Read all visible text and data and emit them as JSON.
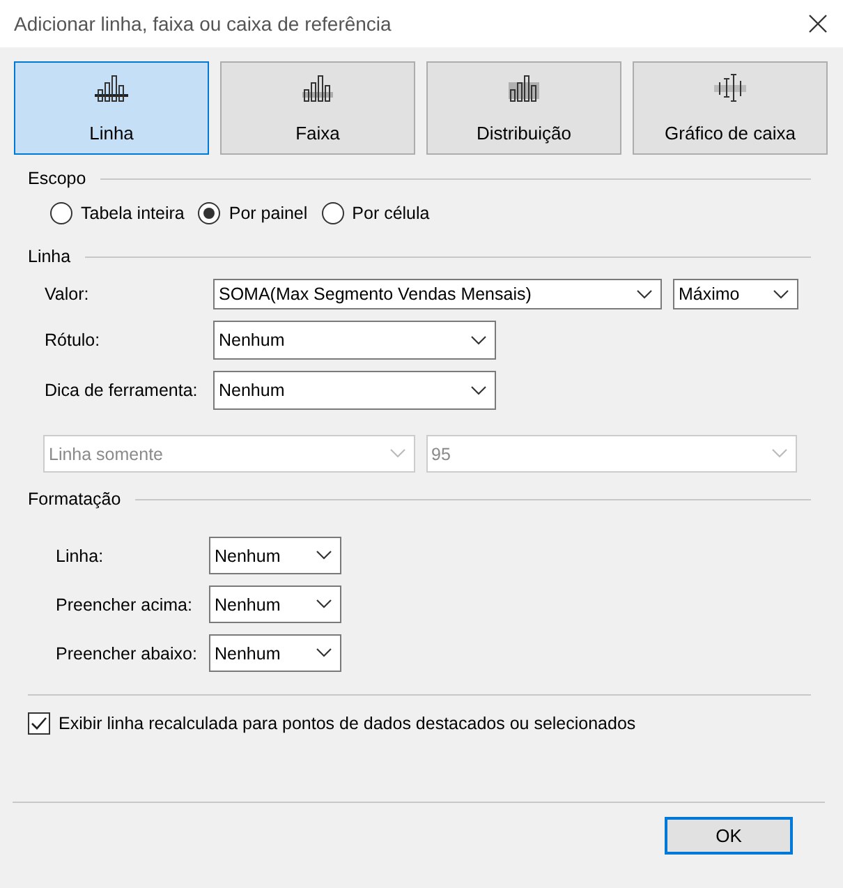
{
  "window": {
    "title": "Adicionar linha, faixa ou caixa de referência"
  },
  "tabs": [
    {
      "label": "Linha",
      "kind": "line",
      "selected": true
    },
    {
      "label": "Faixa",
      "kind": "band",
      "selected": false
    },
    {
      "label": "Distribuição",
      "kind": "distribution",
      "selected": false
    },
    {
      "label": "Gráfico de caixa",
      "kind": "box",
      "selected": false
    }
  ],
  "scope": {
    "title": "Escopo",
    "options": [
      {
        "label": "Tabela inteira",
        "selected": false
      },
      {
        "label": "Por painel",
        "selected": true
      },
      {
        "label": "Por célula",
        "selected": false
      }
    ]
  },
  "line": {
    "title": "Linha",
    "fields": [
      {
        "label": "Valor:",
        "value": "SOMA(Max Segmento Vendas Mensais)",
        "extra": "Máximo"
      },
      {
        "label": "Rótulo:",
        "value": "Nenhum"
      },
      {
        "label": "Dica de ferramenta:",
        "value": "Nenhum"
      }
    ],
    "options": [
      {
        "value": "Linha somente",
        "disabled": true
      },
      {
        "value": "95",
        "disabled": true
      }
    ]
  },
  "formatting": {
    "title": "Formatação",
    "fields": [
      {
        "label": "Linha:",
        "value": "Nenhum"
      },
      {
        "label": "Preencher acima:",
        "value": "Nenhum"
      },
      {
        "label": "Preencher abaixo:",
        "value": "Nenhum"
      }
    ]
  },
  "recalc": {
    "label": "Exibir linha recalculada para pontos de dados destacados ou selecionados",
    "checked": true
  },
  "buttons": [
    {
      "label": "OK",
      "default": true
    }
  ]
}
